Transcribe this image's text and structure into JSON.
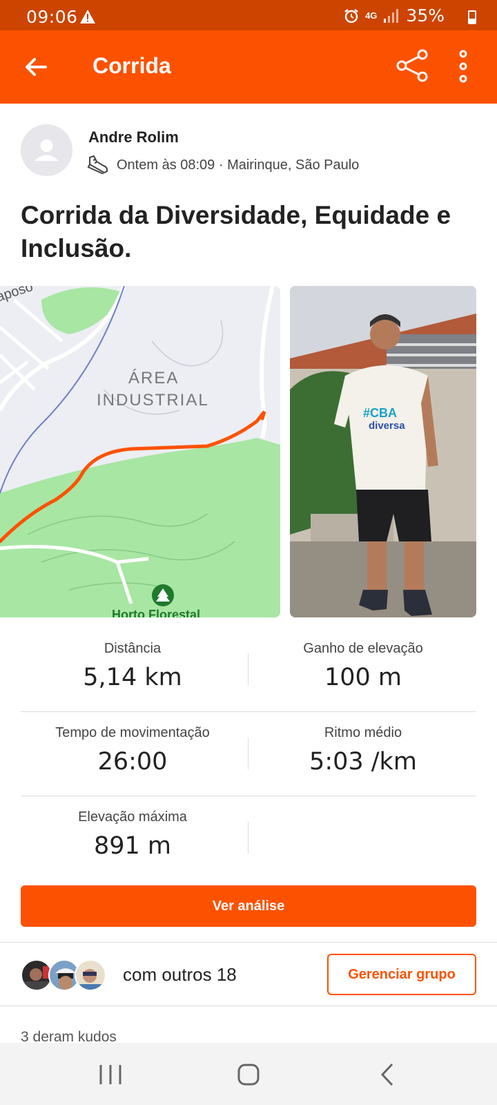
{
  "status_bar": {
    "time": "09:06",
    "network": "4G",
    "battery": "35%",
    "battery_level": 0.35
  },
  "app_bar": {
    "title": "Corrida"
  },
  "activity": {
    "athlete_name": "Andre Rolim",
    "meta": "Ontem às 08:09 · Mairinque, São Paulo",
    "title": "Corrida da Diversidade, Equidade e Inclusão."
  },
  "map": {
    "area_label_line1": "ÁREA",
    "area_label_line2": "INDUSTRIAL",
    "top_left_label": "Raposo",
    "bottom_label": "Horto Florestal"
  },
  "photo": {
    "shirt_text_1": "#CBA",
    "shirt_text_2": "diversa"
  },
  "stats": [
    {
      "label": "Distância",
      "value": "5,14 km"
    },
    {
      "label": "Ganho de elevação",
      "value": "100 m"
    },
    {
      "label": "Tempo de movimentação",
      "value": "26:00"
    },
    {
      "label": "Ritmo médio",
      "value": "5:03 /km"
    },
    {
      "label": "Elevação máxima",
      "value": "891 m"
    }
  ],
  "actions": {
    "analysis_button": "Ver análise",
    "with_others": "com outros 18",
    "manage_group_button": "Gerenciar grupo"
  },
  "kudos": {
    "text": "3 deram kudos"
  },
  "colors": {
    "brand_orange": "#fc5200",
    "status_bar": "#cc4400",
    "route": "#fc5200",
    "park_green": "#a8e6a3"
  }
}
